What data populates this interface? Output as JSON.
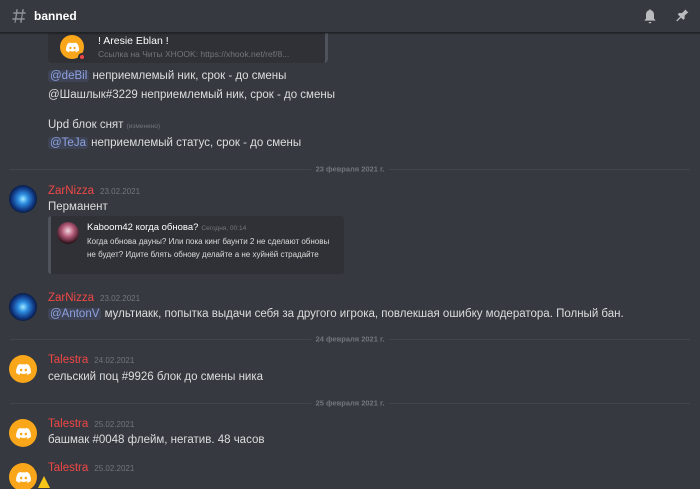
{
  "header": {
    "channel_name": "banned",
    "icons": [
      "hashtag-icon",
      "bell-icon",
      "pin-icon"
    ]
  },
  "embed": {
    "title": "! Aresie Eblan !",
    "body": "Ссылка на Читы XHOOK: https://xhook.net/ref/8..."
  },
  "early_lines": [
    {
      "mention": "@deBil",
      "text": " неприемлемый ник, срок - до смены"
    },
    {
      "mention": "",
      "text": "@Шашлык#3229 неприемлемый ник, срок - до смены"
    },
    {
      "mention": "",
      "text": "Upd блок снят",
      "edited": "(изменено)"
    },
    {
      "mention": "@TeJa",
      "text": " неприемлемый статус, срок - до смены"
    }
  ],
  "dividers": [
    "23 февраля 2021 г.",
    "24 февраля 2021 г.",
    "25 февраля 2021 г."
  ],
  "messages": [
    {
      "author": "ZarNizza",
      "time": "23.02.2021",
      "text": "Перманент"
    },
    {
      "author": "ZarNizza",
      "time": "23.02.2021",
      "mention": "@AntonV",
      "text": " мультиакк, попытка выдачи себя за другого игрока, повлекшая ошибку модератора. Полный бан."
    },
    {
      "author": "Talestra",
      "time": "24.02.2021",
      "text": "сельский поц #9926 блок до смены ника"
    },
    {
      "author": "Talestra",
      "time": "25.02.2021",
      "text": "башмак #0048 флейм, негатив. 48 часов"
    },
    {
      "author": "Talestra",
      "time": "25.02.2021",
      "text": ""
    }
  ],
  "quote": {
    "title": "Kaboom42 когда обнова?",
    "time": "Сегодня, 00:14",
    "body": "Когда обнова дауны? Или пока кинг баунти 2 не сделают обновы не будет? Идите блять обнову делайте а не хуйнёй страдайте"
  },
  "colors": {
    "background": "#36393f",
    "username_red": "#f04747",
    "mention_blue": "#8ea1e1",
    "avatar_yellow": "#faa61a"
  }
}
